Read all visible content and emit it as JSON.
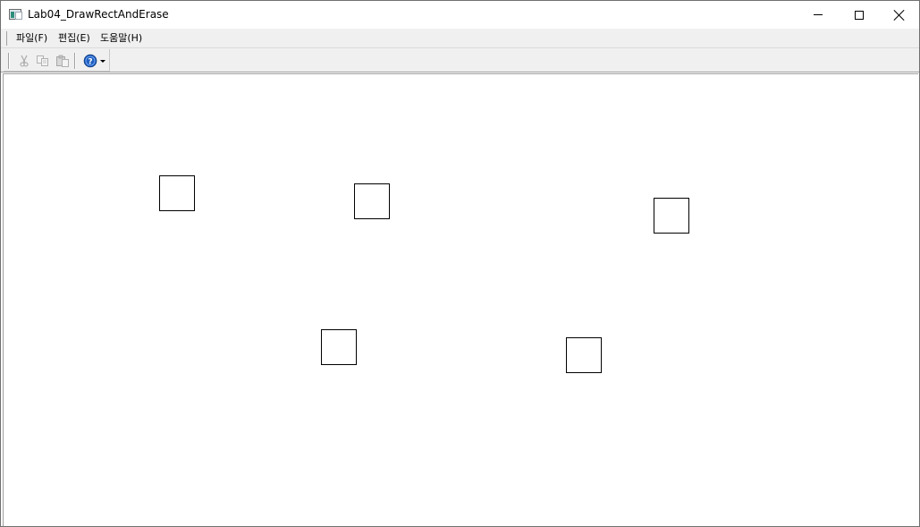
{
  "window": {
    "title": "Lab04_DrawRectAndErase",
    "icon": "app-window-icon",
    "controls": {
      "minimize_icon": "minimize-icon",
      "maximize_icon": "maximize-icon",
      "close_icon": "close-icon"
    }
  },
  "menu": {
    "items": [
      {
        "label": "파일(F)"
      },
      {
        "label": "편집(E)"
      },
      {
        "label": "도움말(H)"
      }
    ]
  },
  "toolbar": {
    "buttons": [
      {
        "icon": "cut-icon",
        "enabled": false
      },
      {
        "icon": "copy-icon",
        "enabled": false
      },
      {
        "icon": "paste-icon",
        "enabled": false
      },
      {
        "icon": "help-icon",
        "enabled": true,
        "has_dropdown": true
      }
    ]
  },
  "colors": {
    "titlebar": "#ffffff",
    "menubar": "#f0f0f0",
    "toolbar": "#f0f0f0",
    "client": "#ffffff",
    "rect_stroke": "#000000",
    "help_icon": "#1f5fbf"
  },
  "canvas": {
    "rectangle_count": 5
  }
}
